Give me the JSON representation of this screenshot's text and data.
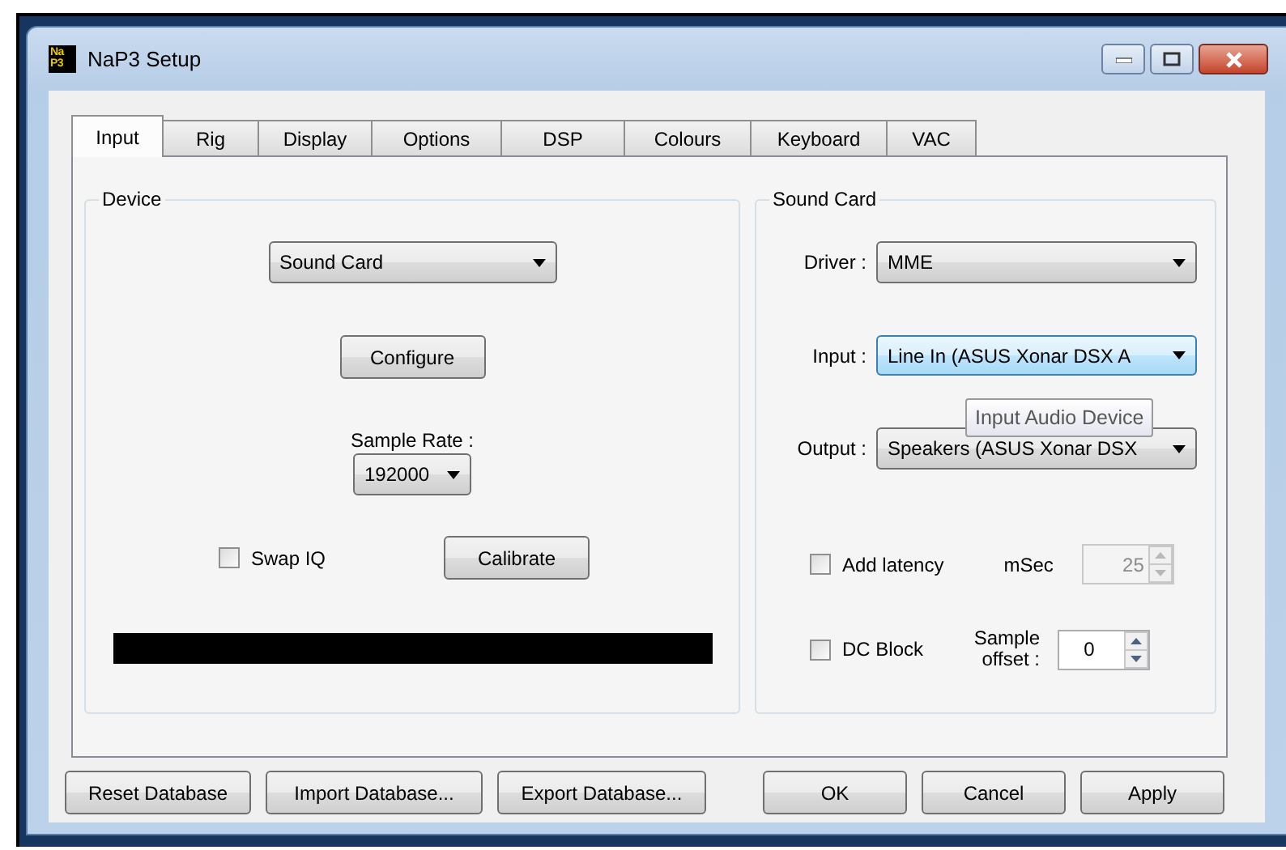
{
  "window": {
    "title": "NaP3 Setup",
    "logo": [
      "Na",
      "P3"
    ]
  },
  "tabs": [
    {
      "label": "Input",
      "selected": true
    },
    {
      "label": "Rig",
      "selected": false
    },
    {
      "label": "Display",
      "selected": false
    },
    {
      "label": "Options",
      "selected": false
    },
    {
      "label": "DSP",
      "selected": false
    },
    {
      "label": "Colours",
      "selected": false
    },
    {
      "label": "Keyboard",
      "selected": false
    },
    {
      "label": "VAC",
      "selected": false
    }
  ],
  "device": {
    "title": "Device",
    "source": "Sound Card",
    "configure": "Configure",
    "sample_rate_label": "Sample Rate :",
    "sample_rate": "192000",
    "swap_iq": {
      "label": "Swap IQ",
      "checked": false
    },
    "calibrate": "Calibrate"
  },
  "sound_card": {
    "title": "Sound Card",
    "fields": [
      {
        "label": "Driver :",
        "value": "MME",
        "focused": false
      },
      {
        "label": "Input :",
        "value": "Line In (ASUS Xonar DSX A",
        "focused": true,
        "tooltip": "Input Audio Device"
      },
      {
        "label": "Output :",
        "value": "Speakers (ASUS Xonar DSX",
        "focused": false
      }
    ],
    "add_latency": {
      "label": "Add latency",
      "checked": false
    },
    "msec": {
      "label": "mSec",
      "value": "25",
      "disabled": true
    },
    "dc_block": {
      "label": "DC Block",
      "checked": false
    },
    "sample_offset": {
      "label": "Sample offset :",
      "value": "0",
      "disabled": false
    }
  },
  "buttons": [
    {
      "label": "Reset Database",
      "kind": "database"
    },
    {
      "label": "Import Database...",
      "kind": "database"
    },
    {
      "label": "Export Database...",
      "kind": "database"
    },
    {
      "label": "OK",
      "kind": "dialog"
    },
    {
      "label": "Cancel",
      "kind": "dialog"
    },
    {
      "label": "Apply",
      "kind": "dialog"
    }
  ]
}
